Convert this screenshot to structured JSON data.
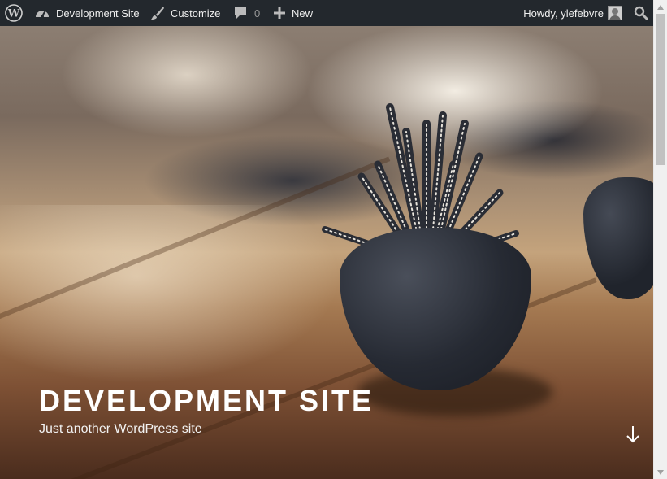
{
  "admin_bar": {
    "wp_logo": "wordpress-logo-icon",
    "site_name": "Development Site",
    "customize_label": "Customize",
    "comments_count": "0",
    "new_label": "New",
    "howdy": "Howdy, ylefebvre"
  },
  "header": {
    "site_title": "DEVELOPMENT SITE",
    "tagline": "Just another WordPress site"
  },
  "colors": {
    "admin_bar_bg": "#23282d",
    "admin_bar_text": "#eeeeee",
    "title_text": "#ffffff"
  }
}
